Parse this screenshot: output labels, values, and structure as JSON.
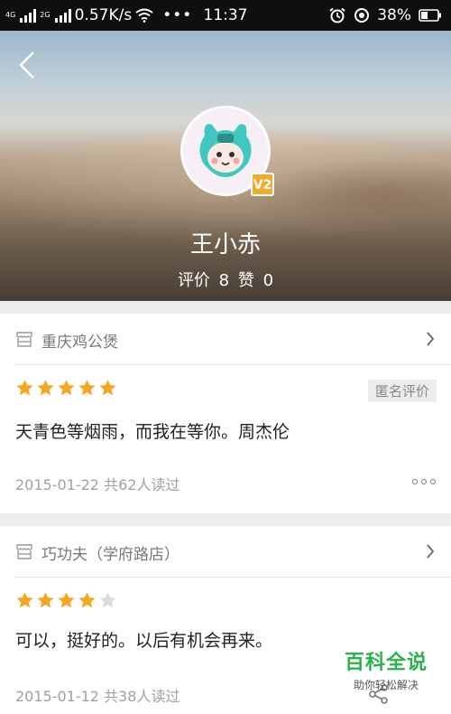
{
  "status_bar": {
    "network_speed": "0.57K/s",
    "time": "11:37",
    "battery": "38%",
    "net1": "4G",
    "net2": "2G"
  },
  "profile": {
    "name": "王小赤",
    "level_badge": "V2",
    "stats_review_label": "评价",
    "stats_review_count": "8",
    "stats_like_label": "赞",
    "stats_like_count": "0"
  },
  "reviews": [
    {
      "shop": "重庆鸡公煲",
      "rating": 5,
      "anonymous_tag": "匿名评价",
      "text": "天青色等烟雨，而我在等你。周杰伦",
      "date": "2015-01-22",
      "reads": "共62人读过"
    },
    {
      "shop": "巧功夫（学府路店）",
      "rating": 4,
      "text": "可以，挺好的。以后有机会再来。",
      "date": "2015-01-12",
      "reads": "共38人读过"
    }
  ],
  "watermark": {
    "title": "百科全说",
    "subtitle": "助你轻松解决"
  },
  "colors": {
    "star": "#f5a623",
    "star_empty": "#dcdcdc",
    "avatar_accent": "#3ec8c0",
    "watermark_green": "#2bb24c"
  }
}
